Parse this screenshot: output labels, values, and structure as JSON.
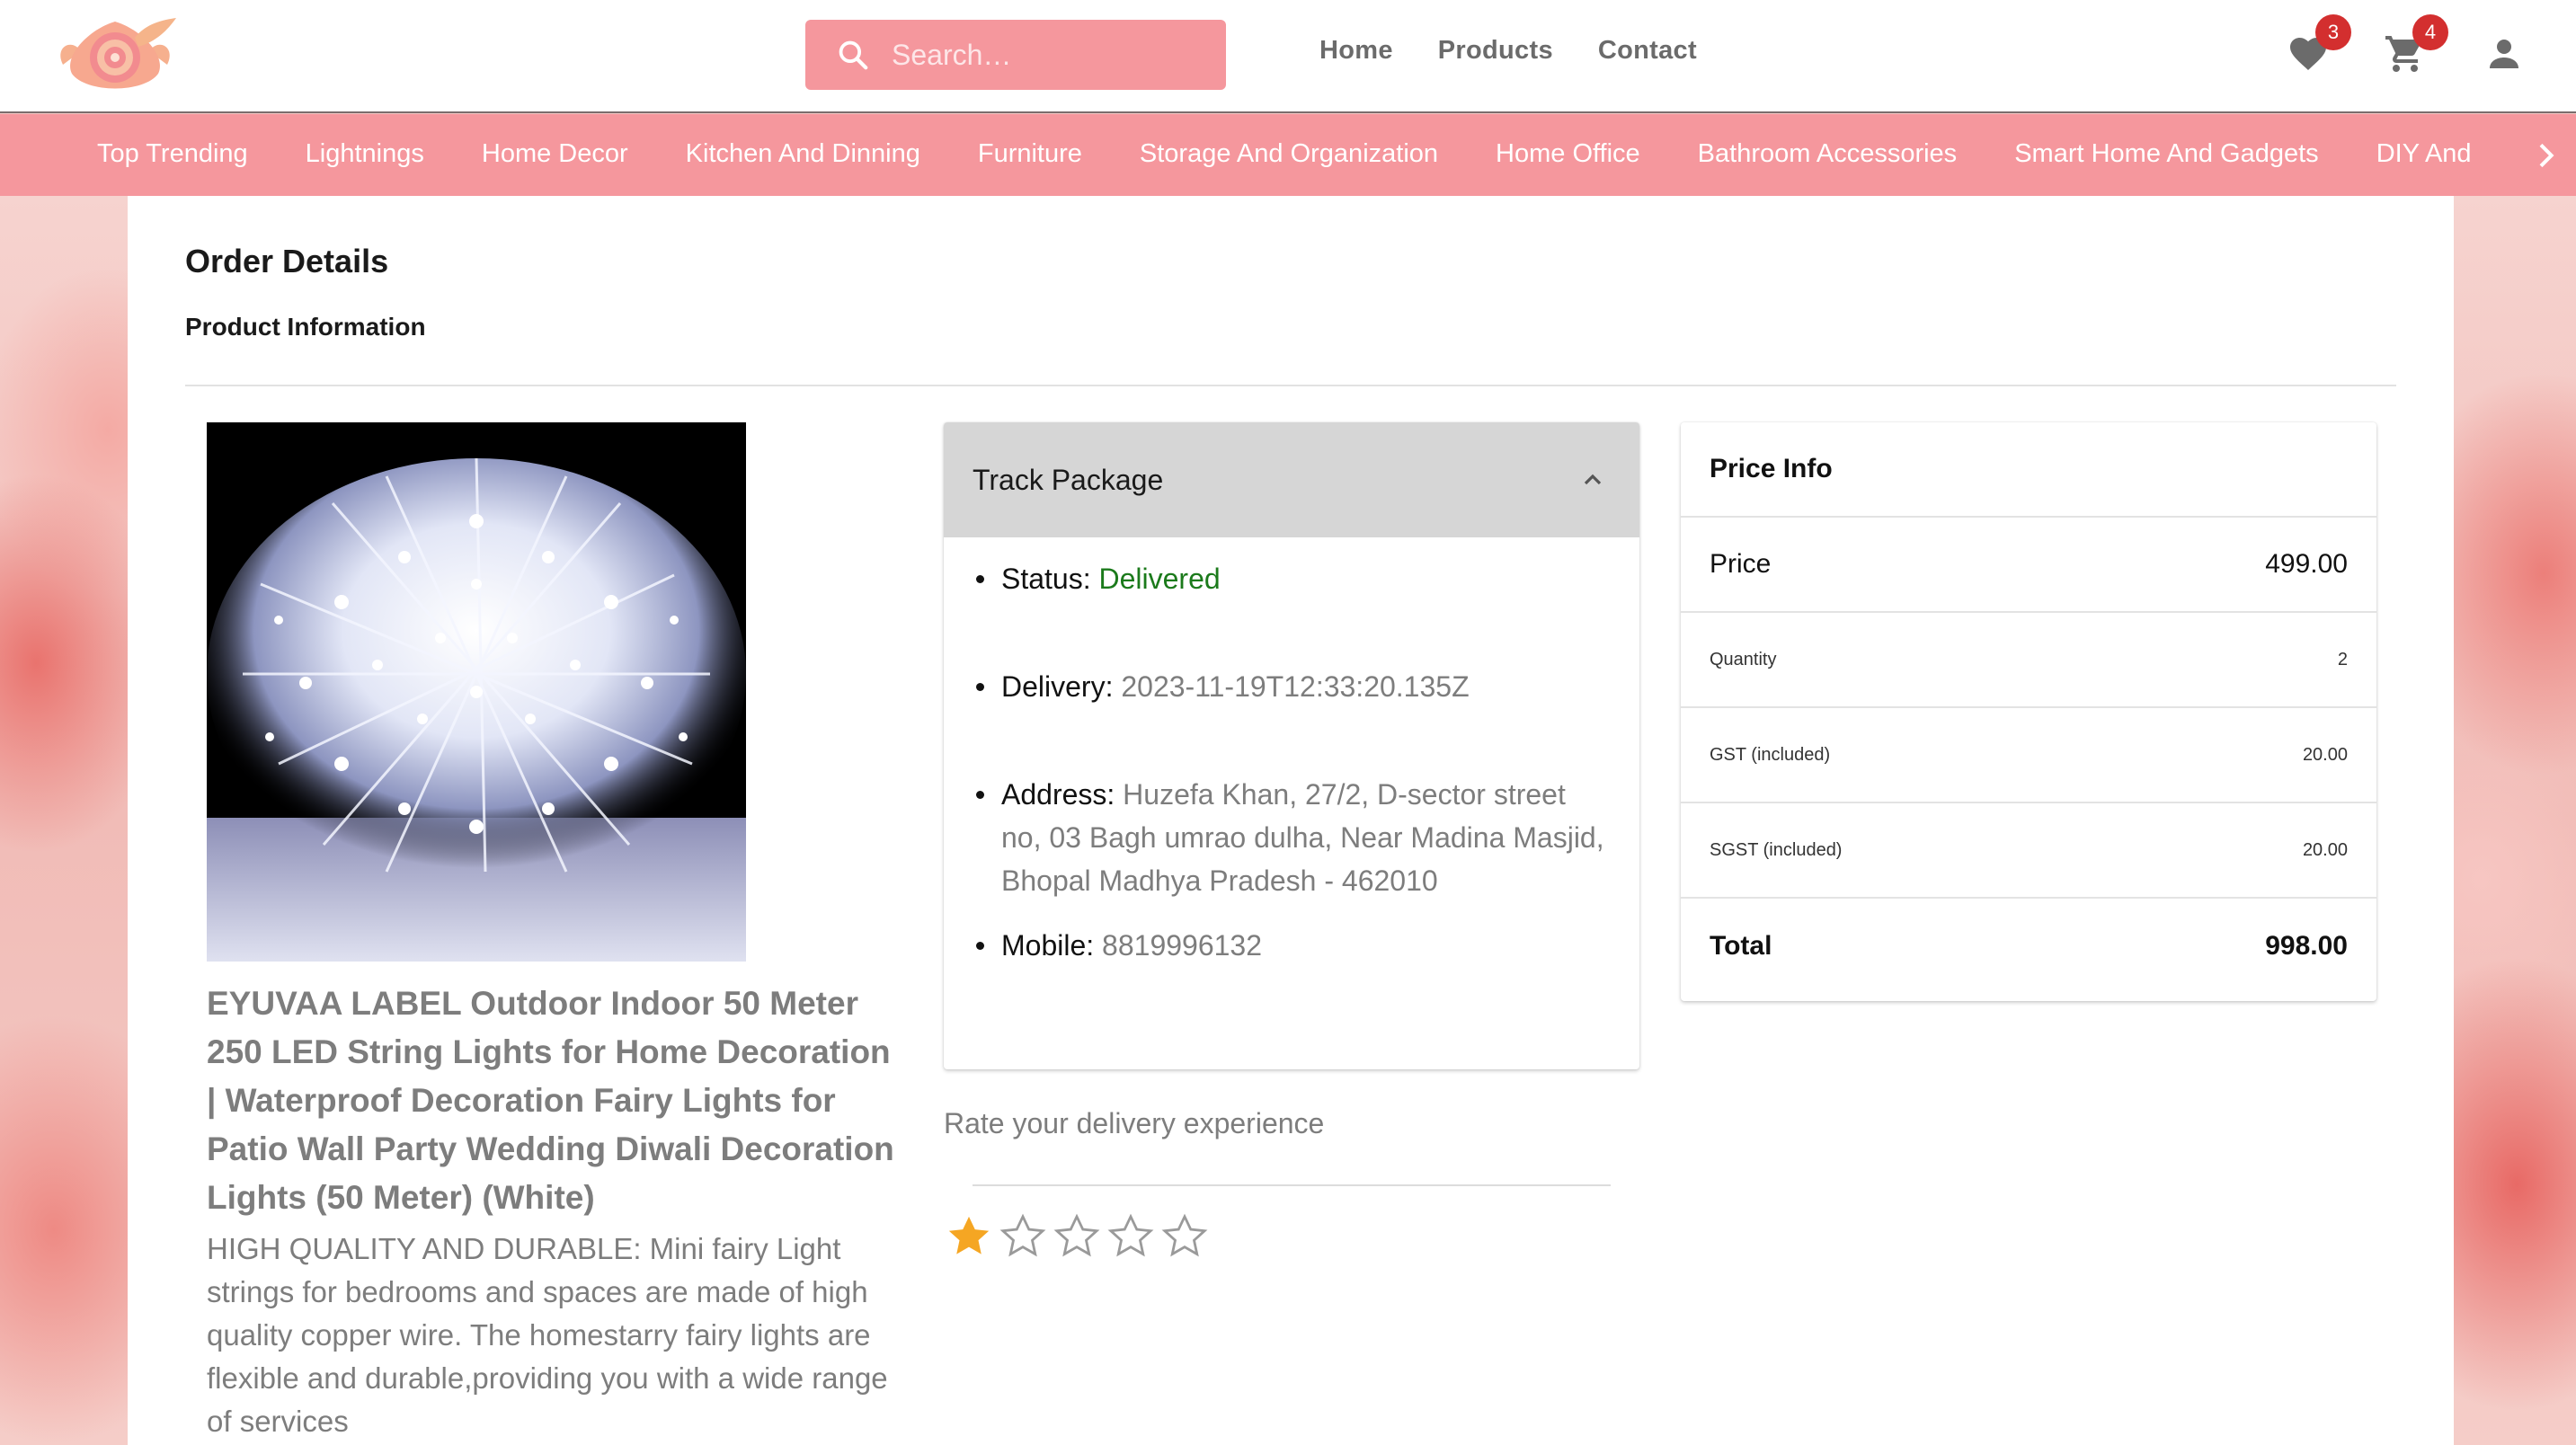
{
  "search": {
    "placeholder": "Search…"
  },
  "topnav": [
    "Home",
    "Products",
    "Contact"
  ],
  "header": {
    "wishlist_count": "3",
    "cart_count": "4"
  },
  "categories": [
    "Top Trending",
    "Lightnings",
    "Home Decor",
    "Kitchen And Dinning",
    "Furniture",
    "Storage And Organization",
    "Home Office",
    "Bathroom Accessories",
    "Smart Home And Gadgets",
    "DIY And"
  ],
  "order": {
    "title": "Order Details",
    "section": "Product Information",
    "product_title": "EYUVAA LABEL Outdoor Indoor 50 Meter 250 LED String Lights for Home Decoration | Waterproof Decoration Fairy Lights for Patio Wall Party Wedding Diwali Decoration Lights (50 Meter) (White)",
    "product_desc": "HIGH QUALITY AND DURABLE: Mini fairy Light strings for bedrooms and spaces are made of high quality copper wire. The homestarry fairy lights are flexible and durable,providing you with a wide range of services"
  },
  "track": {
    "title": "Track Package",
    "status_label": "Status:",
    "status_value": "Delivered",
    "delivery_label": "Delivery:",
    "delivery_value": "2023-11-19T12:33:20.135Z",
    "address_label": "Address:",
    "address_value": "Huzefa Khan, 27/2, D-sector street no, 03 Bagh umrao dulha, Near Madina Masjid, Bhopal Madhya Pradesh - 462010",
    "mobile_label": "Mobile:",
    "mobile_value": "8819996132"
  },
  "rating": {
    "label": "Rate your delivery experience",
    "value": 1,
    "max": 5
  },
  "price": {
    "title": "Price Info",
    "rows": [
      {
        "label": "Price",
        "value": "499.00"
      },
      {
        "label": "Quantity",
        "value": "2"
      },
      {
        "label": "GST (included)",
        "value": "20.00"
      },
      {
        "label": "SGST (included)",
        "value": "20.00"
      },
      {
        "label": "Total",
        "value": "998.00"
      }
    ]
  },
  "colors": {
    "brand_pink": "#f5979d",
    "delivered_green": "#1b7a1b",
    "star_gold": "#f5a623",
    "badge_red": "#d32f2f"
  }
}
